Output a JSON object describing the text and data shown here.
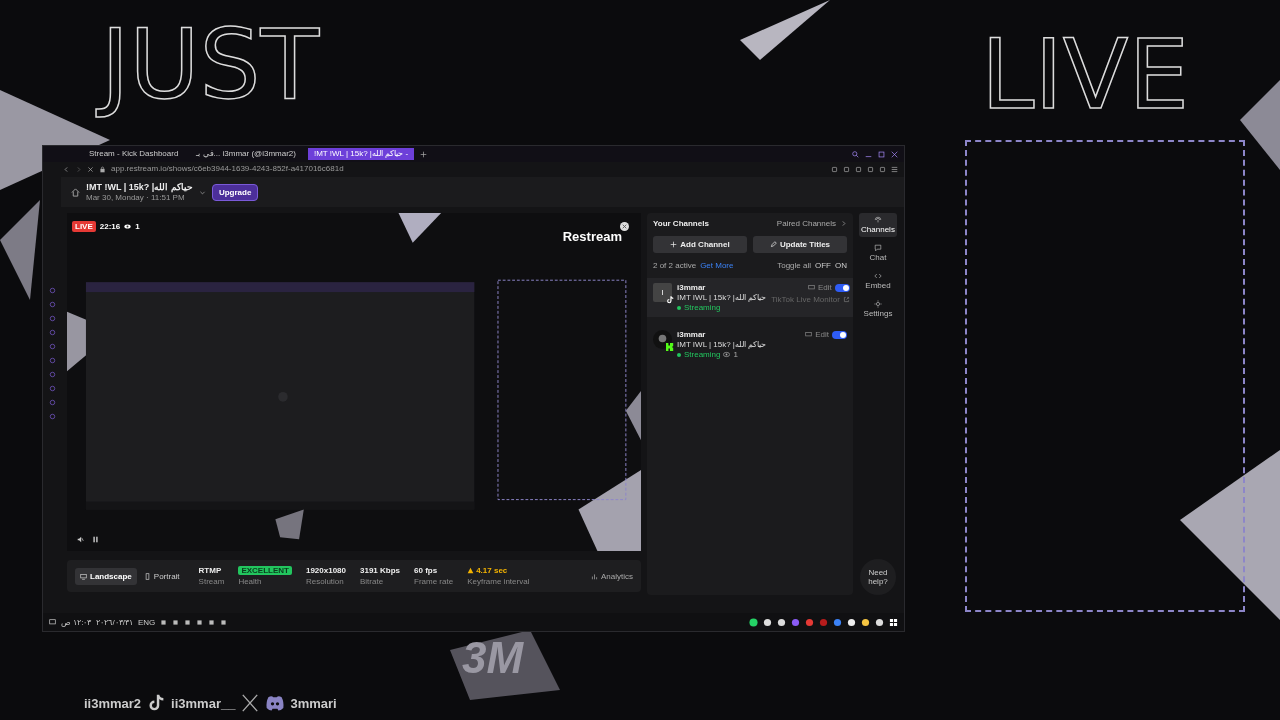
{
  "overlay": {
    "title_left": "JUST",
    "title_right": "LIVE",
    "logo": "3M",
    "socials": [
      {
        "kind": "tiktok",
        "handle": "ii3mmar2"
      },
      {
        "kind": "x",
        "handle": "ii3mmar__"
      },
      {
        "kind": "discord",
        "handle": "3mmari"
      }
    ]
  },
  "browser": {
    "tabs": [
      {
        "label": "Stream - Kick Dashboard",
        "selected": false
      },
      {
        "label": "في بـ... i3mmar (@i3mmar2)",
        "selected": false
      },
      {
        "label": "!MT !WL | 15k? |حياكم الله -",
        "selected": true
      }
    ],
    "url": "app.restream.io/shows/c6eb3944-1639-4243-852f-a417016c681d"
  },
  "header": {
    "title": "!MT !WL | 15k? |حياكم الله",
    "date": "Mar 30, Monday · 11:51 PM",
    "upgrade": "Upgrade"
  },
  "preview": {
    "live": "LIVE",
    "time": "22:16",
    "viewers": "1",
    "brand": "Restream"
  },
  "orientations": [
    {
      "label": "Landscape",
      "selected": true
    },
    {
      "label": "Portrait",
      "selected": false
    }
  ],
  "stats": [
    {
      "kind": "plain",
      "value": "RTMP",
      "label": "Stream"
    },
    {
      "kind": "badge",
      "value": "EXCELLENT",
      "label": "Health"
    },
    {
      "kind": "plain",
      "value": "1920x1080",
      "label": "Resolution"
    },
    {
      "kind": "plain",
      "value": "3191 Kbps",
      "label": "Bitrate"
    },
    {
      "kind": "plain",
      "value": "60 fps",
      "label": "Frame rate"
    },
    {
      "kind": "warning",
      "value": "4.17 sec",
      "label": "Keyframe interval"
    }
  ],
  "analytics": "Analytics",
  "channels_panel": {
    "heading": "Your Channels",
    "paired": "Paired Channels",
    "add": "Add Channel",
    "update": "Update Titles",
    "count": "2 of 2 active",
    "more": "Get More",
    "toggle_all": "Toggle all",
    "off": "OFF",
    "on": "ON"
  },
  "channels": [
    {
      "kind": "tiktok",
      "avatar": "I",
      "name": "i3mmar",
      "title": "IMT IWL | 15k? |حياكم الله",
      "status": "Streaming",
      "edit": "Edit",
      "on": true,
      "extra": "TikTok Live Monitor"
    },
    {
      "kind": "kick",
      "name": "i3mmar",
      "title": "IMT IWL | 15k? |حياكم الله",
      "status": "Streaming",
      "edit": "Edit",
      "on": true,
      "viewers": "1"
    }
  ],
  "side_nav": [
    {
      "kind": "channels",
      "label": "Channels",
      "selected": true
    },
    {
      "kind": "chat",
      "label": "Chat",
      "selected": false
    },
    {
      "kind": "embed",
      "label": "Embed",
      "selected": false
    },
    {
      "kind": "settings",
      "label": "Settings",
      "selected": false
    }
  ],
  "help": "Need help?",
  "taskbar": {
    "time": "١٢:٠٣ ص",
    "date": "٢٠٢٦/٠٣/٣١",
    "lang": "ENG"
  }
}
